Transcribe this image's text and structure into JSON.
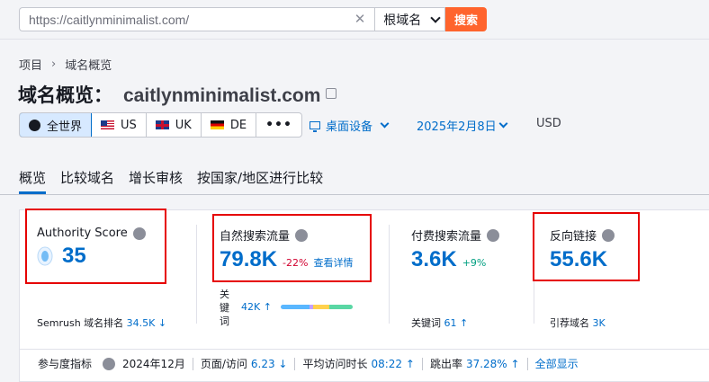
{
  "search": {
    "url_value": "https://caitlynminimalist.com/",
    "clear": "✕",
    "scope": "根域名",
    "button": "搜索"
  },
  "breadcrumb": {
    "root": "项目",
    "separator": "›",
    "current": "域名概览"
  },
  "title": {
    "label": "域名概览：",
    "domain": "caitlynminimalist.com"
  },
  "regions": [
    {
      "label": "全世界",
      "icon": "globe-icon",
      "active": true
    },
    {
      "label": "US",
      "icon": "flag-us-icon",
      "active": false
    },
    {
      "label": "UK",
      "icon": "flag-uk-icon",
      "active": false
    },
    {
      "label": "DE",
      "icon": "flag-de-icon",
      "active": false
    },
    {
      "label": "•••",
      "icon": "more-icon",
      "active": false
    }
  ],
  "device": "桌面设备",
  "date": "2025年2月8日",
  "currency": "USD",
  "tabs": [
    "概览",
    "比较域名",
    "增长审核",
    "按国家/地区进行比较"
  ],
  "metrics": {
    "authority": {
      "label": "Authority Score",
      "value": "35",
      "sub_label": "Semrush 域名排名",
      "sub_value": "34.5K ↓"
    },
    "organic": {
      "label": "自然搜索流量",
      "value": "79.8K",
      "change": "-22%",
      "link": "查看详情",
      "kw_label": "关\n键\n词",
      "kw_value": "42K ↑"
    },
    "paid": {
      "label": "付费搜索流量",
      "value": "3.6K",
      "change": "+9%",
      "sub_label": "关键词",
      "sub_value": "61 ↑"
    },
    "backlinks": {
      "label": "反向链接",
      "value": "55.6K",
      "sub_label": "引荐域名",
      "sub_value": "3K"
    }
  },
  "engagement": {
    "label": "参与度指标",
    "month": "2024年12月",
    "pages_label": "页面/访问",
    "pages_value": "6.23 ↓",
    "duration_label": "平均访问时长",
    "duration_value": "08:22 ↑",
    "bounce_label": "跳出率",
    "bounce_value": "37.28% ↑",
    "show_all": "全部显示"
  },
  "colors": {
    "accent": "#006dca",
    "brand": "#ff642d",
    "highlight": "#e60000"
  }
}
